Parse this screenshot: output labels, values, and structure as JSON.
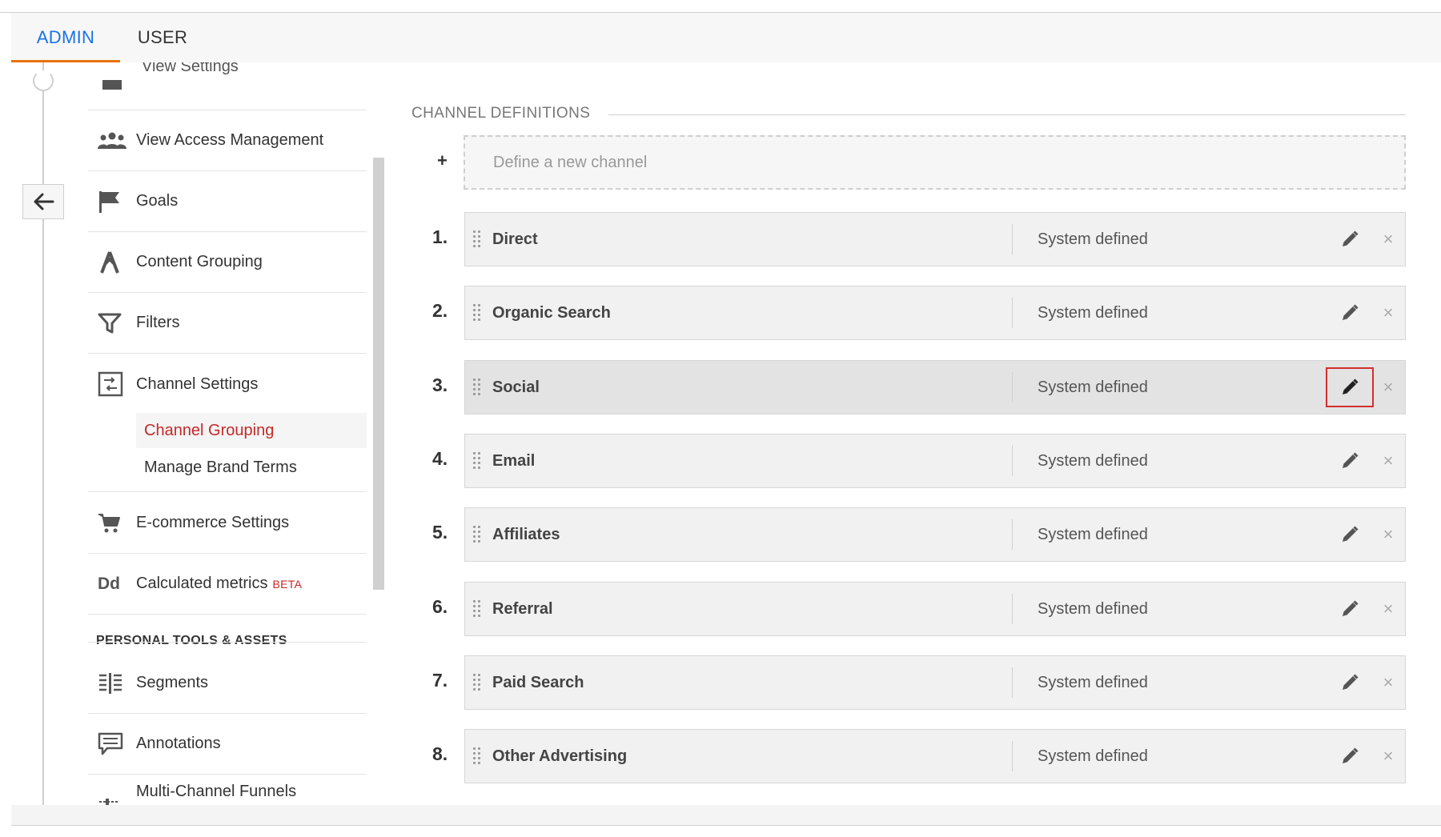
{
  "tabs": [
    {
      "label": "ADMIN",
      "active": true
    },
    {
      "label": "USER",
      "active": false
    }
  ],
  "sidebar": {
    "partial_item": {
      "label": "View Settings",
      "icon": "settings-icon"
    },
    "items": [
      {
        "label": "View Access Management",
        "icon": "people-icon"
      },
      {
        "label": "Goals",
        "icon": "flag-icon"
      },
      {
        "label": "Content Grouping",
        "icon": "person-walking-icon"
      },
      {
        "label": "Filters",
        "icon": "filter-icon"
      },
      {
        "label": "Channel Settings",
        "icon": "channel-settings-icon"
      },
      {
        "label": "E-commerce Settings",
        "icon": "cart-icon"
      },
      {
        "label": "Calculated metrics",
        "icon": "dd-icon",
        "badge": "BETA",
        "icon_text": "Dd"
      }
    ],
    "sub_items": [
      {
        "label": "Channel Grouping",
        "active": true
      },
      {
        "label": "Manage Brand Terms",
        "active": false
      }
    ],
    "section_heading": "PERSONAL TOOLS & ASSETS",
    "personal_items": [
      {
        "label": "Segments",
        "icon": "segments-icon"
      },
      {
        "label": "Annotations",
        "icon": "annotation-icon"
      },
      {
        "label": "Multi-Channel Funnels",
        "icon": "funnel-settings-icon"
      }
    ]
  },
  "main": {
    "section_title": "CHANNEL DEFINITIONS",
    "add_symbol": "+",
    "new_channel_placeholder": "Define a new channel",
    "channels": [
      {
        "number": "1.",
        "name": "Direct",
        "type": "System defined"
      },
      {
        "number": "2.",
        "name": "Organic Search",
        "type": "System defined"
      },
      {
        "number": "3.",
        "name": "Social",
        "type": "System defined",
        "highlighted": true
      },
      {
        "number": "4.",
        "name": "Email",
        "type": "System defined"
      },
      {
        "number": "5.",
        "name": "Affiliates",
        "type": "System defined"
      },
      {
        "number": "6.",
        "name": "Referral",
        "type": "System defined"
      },
      {
        "number": "7.",
        "name": "Paid Search",
        "type": "System defined"
      },
      {
        "number": "8.",
        "name": "Other Advertising",
        "type": "System defined"
      }
    ],
    "close_symbol": "×"
  },
  "colors": {
    "accent_blue": "#1a73e8",
    "tab_underline": "#e8710a",
    "active_red": "#c62828",
    "focus_outline": "#d32f2f"
  }
}
